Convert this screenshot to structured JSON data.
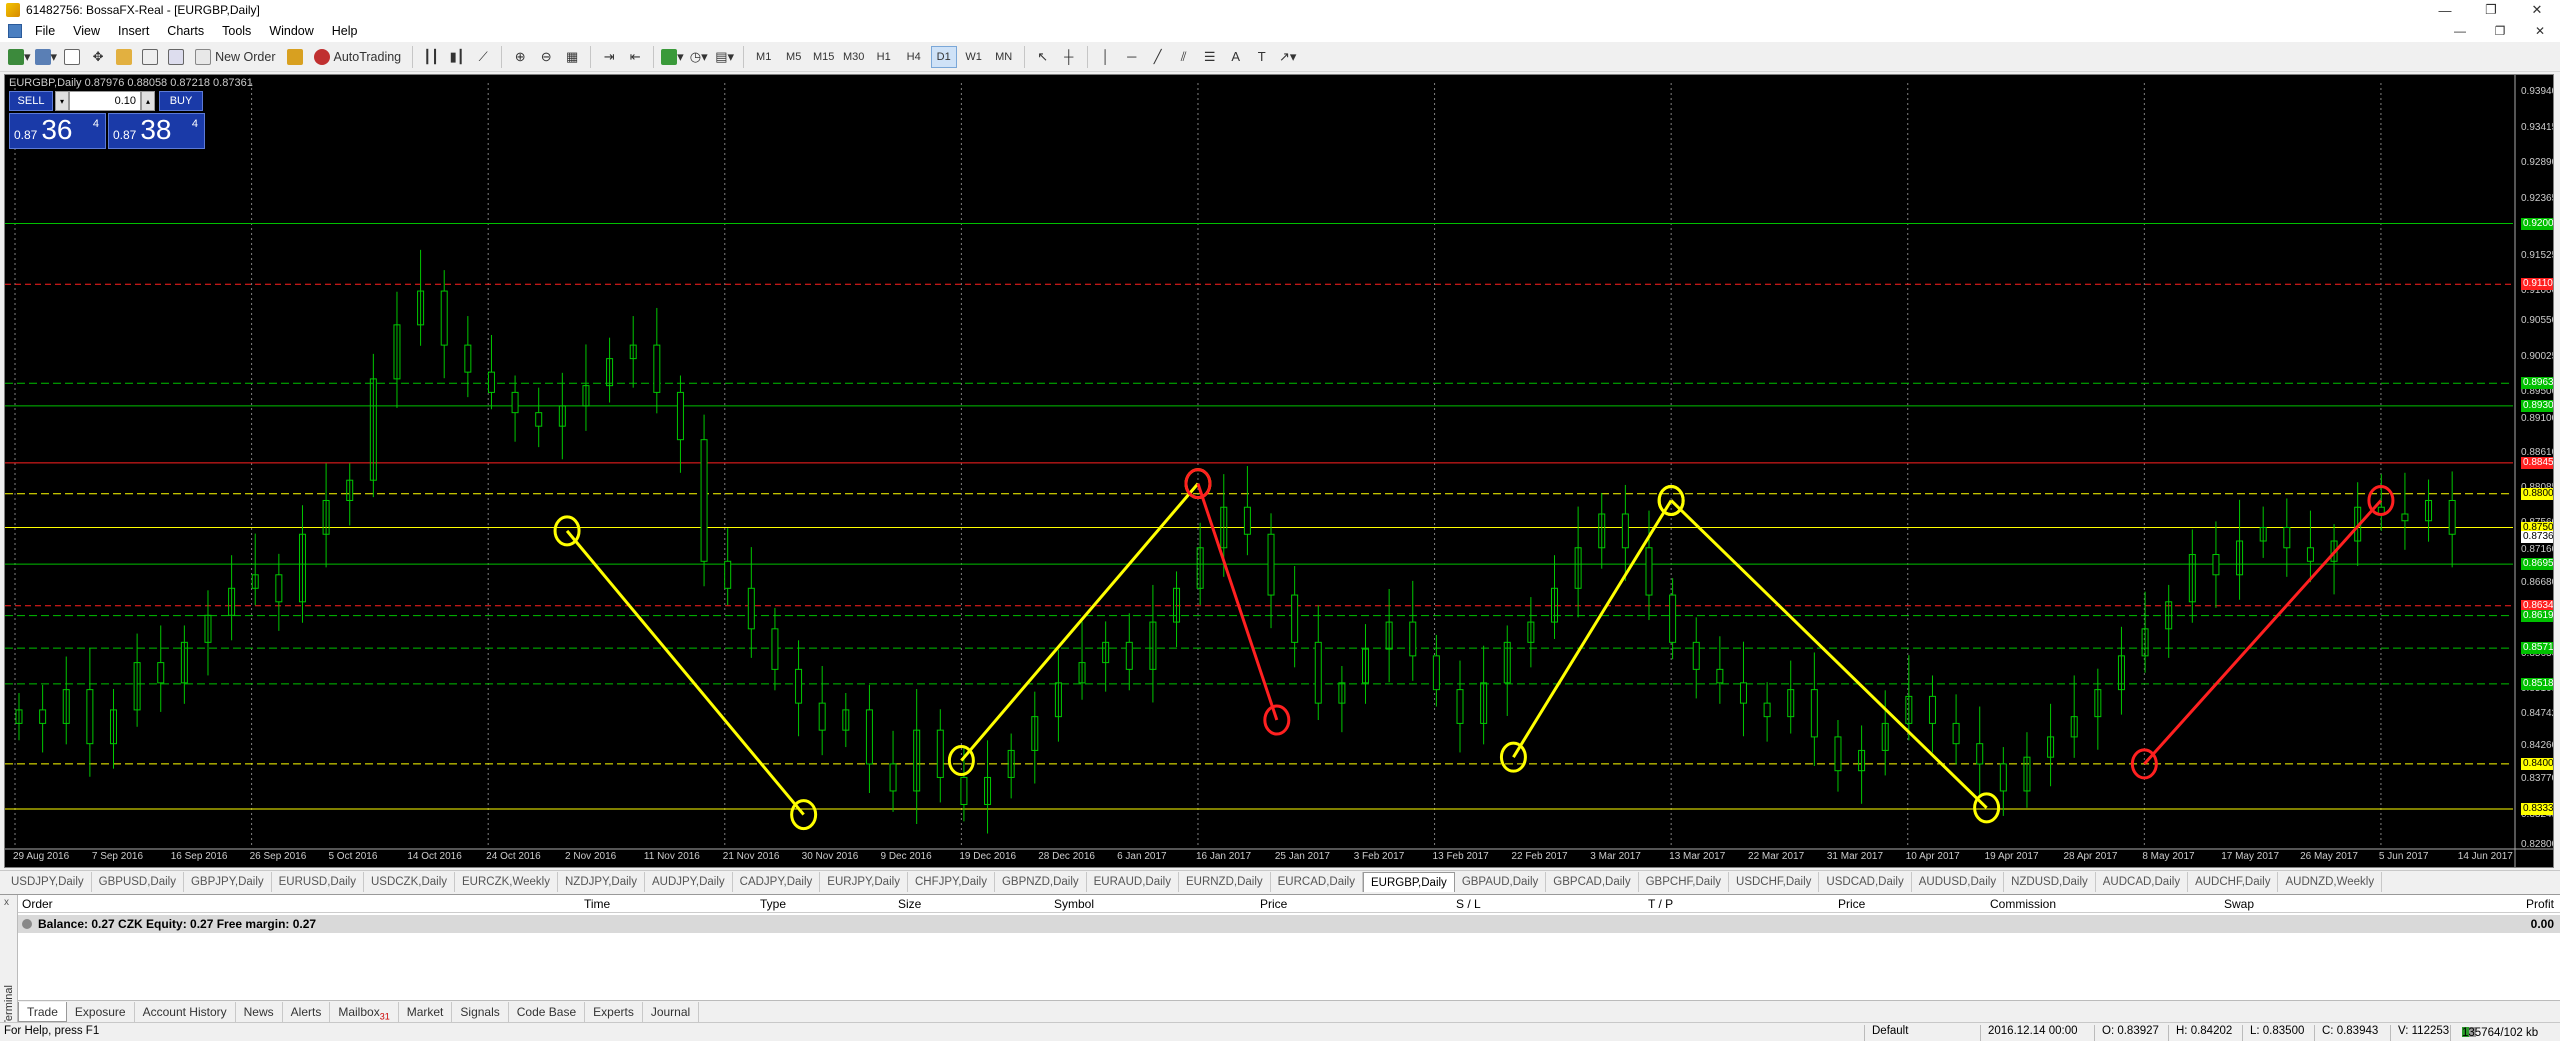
{
  "window": {
    "title": "61482756: BossaFX-Real - [EURGBP,Daily]",
    "min": "—",
    "restore": "❐",
    "close": "✕"
  },
  "menu": [
    "File",
    "View",
    "Insert",
    "Charts",
    "Tools",
    "Window",
    "Help"
  ],
  "toolbar": {
    "new_order": "New Order",
    "autotrading": "AutoTrading",
    "timeframes": [
      "M1",
      "M5",
      "M15",
      "M30",
      "H1",
      "H4",
      "D1",
      "W1",
      "MN"
    ],
    "active_timeframe": "D1"
  },
  "chart": {
    "label": "EURGBP,Daily  0.87976 0.88058 0.87218 0.87361",
    "trade_panel": {
      "sell": "SELL",
      "buy": "BUY",
      "lot": "0.10",
      "bid_prefix": "0.87",
      "bid_big": "36",
      "bid_sup": "4",
      "ask_prefix": "0.87",
      "ask_big": "38",
      "ask_sup": "4"
    },
    "colors": {
      "candle": "#00c800",
      "grid": "#808080",
      "yellow": "#ffff00",
      "red": "#ff2020",
      "green_line": "#00c000"
    }
  },
  "chart_data": {
    "type": "candlestick",
    "title": "EURGBP,Daily",
    "ylim": [
      0.828,
      0.9408
    ],
    "y_ticks": [
      "0.93940",
      "0.93415",
      "0.92890",
      "0.92365",
      "0.91525",
      "0.91000",
      "0.90550",
      "0.90025",
      "0.89500",
      "0.89100",
      "0.88610",
      "0.88085",
      "0.87560",
      "0.87160",
      "0.86680",
      "0.86155",
      "0.85630",
      "0.85105",
      "0.84742",
      "0.84260",
      "0.83770",
      "0.83245",
      "0.82800"
    ],
    "x_ticks": [
      "29 Aug 2016",
      "7 Sep 2016",
      "16 Sep 2016",
      "26 Sep 2016",
      "5 Oct 2016",
      "14 Oct 2016",
      "24 Oct 2016",
      "2 Nov 2016",
      "11 Nov 2016",
      "21 Nov 2016",
      "30 Nov 2016",
      "9 Dec 2016",
      "19 Dec 2016",
      "28 Dec 2016",
      "6 Jan 2017",
      "16 Jan 2017",
      "25 Jan 2017",
      "3 Feb 2017",
      "13 Feb 2017",
      "22 Feb 2017",
      "3 Mar 2017",
      "13 Mar 2017",
      "22 Mar 2017",
      "31 Mar 2017",
      "10 Apr 2017",
      "19 Apr 2017",
      "28 Apr 2017",
      "8 May 2017",
      "17 May 2017",
      "26 May 2017",
      "5 Jun 2017",
      "14 Jun 2017"
    ],
    "price_tags": [
      {
        "value": 0.92,
        "label": "0.92000",
        "color": "#00c000"
      },
      {
        "value": 0.911,
        "label": "0.91100",
        "color": "#ff2020"
      },
      {
        "value": 0.89635,
        "label": "0.89635",
        "color": "#00c000"
      },
      {
        "value": 0.893,
        "label": "0.89300",
        "color": "#00c000"
      },
      {
        "value": 0.88457,
        "label": "0.88457",
        "color": "#ff2020"
      },
      {
        "value": 0.88,
        "label": "0.88000",
        "color": "#ffff00"
      },
      {
        "value": 0.875,
        "label": "0.87500",
        "color": "#ffff00"
      },
      {
        "value": 0.87361,
        "label": "0.87361",
        "color": "#ffffff"
      },
      {
        "value": 0.86957,
        "label": "0.86957",
        "color": "#00c000"
      },
      {
        "value": 0.86341,
        "label": "0.86341",
        "color": "#ff2020"
      },
      {
        "value": 0.86196,
        "label": "0.86196",
        "color": "#00c000"
      },
      {
        "value": 0.85714,
        "label": "0.85714",
        "color": "#00c000"
      },
      {
        "value": 0.85185,
        "label": "0.85185",
        "color": "#00c000"
      },
      {
        "value": 0.84,
        "label": "0.84000",
        "color": "#ffff00"
      },
      {
        "value": 0.83333,
        "label": "0.83333",
        "color": "#ffff00"
      }
    ],
    "series": [
      {
        "name": "EURGBP",
        "close": [
          0.848,
          0.846,
          0.851,
          0.843,
          0.848,
          0.855,
          0.852,
          0.858,
          0.862,
          0.866,
          0.868,
          0.864,
          0.874,
          0.879,
          0.882,
          0.897,
          0.905,
          0.91,
          0.902,
          0.898,
          0.895,
          0.892,
          0.89,
          0.893,
          0.896,
          0.9,
          0.902,
          0.895,
          0.888,
          0.87,
          0.866,
          0.86,
          0.854,
          0.849,
          0.845,
          0.848,
          0.84,
          0.836,
          0.845,
          0.838,
          0.834,
          0.838,
          0.842,
          0.847,
          0.852,
          0.855,
          0.858,
          0.854,
          0.861,
          0.866,
          0.872,
          0.878,
          0.874,
          0.865,
          0.858,
          0.849,
          0.852,
          0.857,
          0.861,
          0.856,
          0.851,
          0.846,
          0.852,
          0.858,
          0.861,
          0.866,
          0.872,
          0.877,
          0.872,
          0.865,
          0.858,
          0.854,
          0.852,
          0.849,
          0.847,
          0.851,
          0.844,
          0.839,
          0.842,
          0.846,
          0.85,
          0.846,
          0.843,
          0.84,
          0.836,
          0.841,
          0.844,
          0.847,
          0.851,
          0.856,
          0.86,
          0.864,
          0.871,
          0.868,
          0.873,
          0.875,
          0.872,
          0.87,
          0.873,
          0.878,
          0.877,
          0.876,
          0.879,
          0.874
        ]
      }
    ],
    "annotations": [
      {
        "type": "trend",
        "color": "yellow",
        "from": [
          "2 Nov 2016",
          0.8745
        ],
        "to": [
          "30 Nov 2016",
          0.8325
        ]
      },
      {
        "type": "trend",
        "color": "yellow",
        "from": [
          "19 Dec 2016",
          0.8405
        ],
        "to": [
          "16 Jan 2017",
          0.8815
        ]
      },
      {
        "type": "trend",
        "color": "red",
        "from": [
          "16 Jan 2017",
          0.8815
        ],
        "to": [
          "25 Jan 2017",
          0.8465
        ]
      },
      {
        "type": "trend",
        "color": "yellow",
        "from": [
          "22 Feb 2017",
          0.841
        ],
        "to": [
          "13 Mar 2017",
          0.879
        ]
      },
      {
        "type": "trend",
        "color": "yellow",
        "from": [
          "13 Mar 2017",
          0.879
        ],
        "to": [
          "19 Apr 2017",
          0.8335
        ]
      },
      {
        "type": "trend",
        "color": "red",
        "from": [
          "8 May 2017",
          0.84
        ],
        "to": [
          "5 Jun 2017",
          0.879
        ]
      }
    ]
  },
  "symbol_tabs": [
    "USDJPY,Daily",
    "GBPUSD,Daily",
    "GBPJPY,Daily",
    "EURUSD,Daily",
    "USDCZK,Daily",
    "EURCZK,Weekly",
    "NZDJPY,Daily",
    "AUDJPY,Daily",
    "CADJPY,Daily",
    "EURJPY,Daily",
    "CHFJPY,Daily",
    "GBPNZD,Daily",
    "EURAUD,Daily",
    "EURNZD,Daily",
    "EURCAD,Daily",
    "EURGBP,Daily",
    "GBPAUD,Daily",
    "GBPCAD,Daily",
    "GBPCHF,Daily",
    "USDCHF,Daily",
    "USDCAD,Daily",
    "AUDUSD,Daily",
    "NZDUSD,Daily",
    "AUDCAD,Daily",
    "AUDCHF,Daily",
    "AUDNZD,Weekly"
  ],
  "active_symbol_tab": "EURGBP,Daily",
  "terminal": {
    "side_label": "Terminal",
    "close": "x",
    "columns": [
      "Order",
      "Time",
      "Type",
      "Size",
      "Symbol",
      "Price",
      "S / L",
      "T / P",
      "Price",
      "Commission",
      "Swap",
      "Profit"
    ],
    "balance": "Balance: 0.27 CZK  Equity: 0.27  Free margin: 0.27",
    "profit": "0.00",
    "tabs": [
      "Trade",
      "Exposure",
      "Account History",
      "News",
      "Alerts",
      "Mailbox",
      "Market",
      "Signals",
      "Code Base",
      "Experts",
      "Journal"
    ],
    "mailbox_count": "31",
    "active_tab": "Trade"
  },
  "status": {
    "help": "For Help, press F1",
    "profile": "Default",
    "datetime": "2016.12.14 00:00",
    "open": "O: 0.83927",
    "high": "H: 0.84202",
    "low": "L: 0.83500",
    "close": "C: 0.83943",
    "volume": "V: 112253",
    "traffic": "135764/102 kb"
  }
}
